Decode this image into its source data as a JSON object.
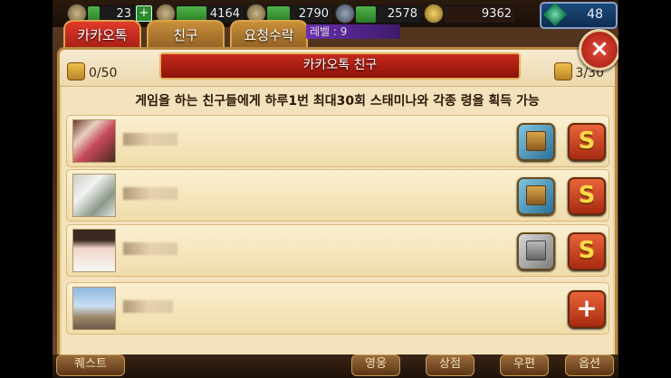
{
  "resources": [
    {
      "name": "stamina-icon",
      "value": "23",
      "fill": 0.25
    },
    {
      "name": "sword-icon",
      "value": "4164",
      "fill": 0.45
    },
    {
      "name": "helmet-icon",
      "value": "2790",
      "fill": 0.35
    },
    {
      "name": "ore-icon",
      "value": "2578",
      "fill": 0.3
    }
  ],
  "gold": "9362",
  "gems": "48",
  "tabs": [
    {
      "label": "카카오톡",
      "active": true
    },
    {
      "label": "친구",
      "active": false
    },
    {
      "label": "요청수락",
      "active": false
    }
  ],
  "level_text": "레벨 : 9",
  "panel": {
    "title": "카카오톡 친구",
    "left_count": "0/50",
    "right_count": "3/30",
    "description": "게임을 하는 친구들에게 하루1번 최대30회 스태미나와 각종 령을 획득 가능",
    "close_label": "×"
  },
  "friends": [
    {
      "gift": "gold",
      "send_label": "S"
    },
    {
      "gift": "gold",
      "send_label": "S"
    },
    {
      "gift": "gray",
      "send_label": "S"
    },
    {
      "gift": "none",
      "send_label": "+"
    }
  ],
  "bottom_menu": [
    "퀘스트",
    "영웅",
    "상점",
    "우편",
    "옵션"
  ],
  "colors": {
    "accent": "#c52a1c",
    "panel_bg": "#f3e3bd",
    "gold": "#ffd84a"
  }
}
